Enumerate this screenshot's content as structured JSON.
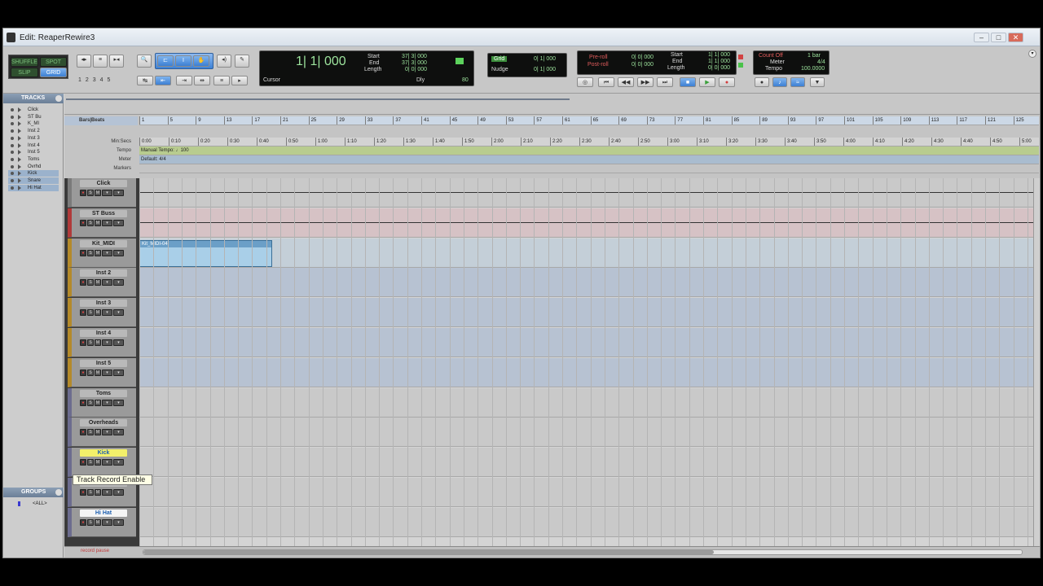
{
  "window": {
    "title": "Edit: ReaperRewire3",
    "minimize": "–",
    "maximize": "□",
    "close": "✕"
  },
  "edit_modes": {
    "shuffle": "SHUFFLE",
    "spot": "SPOT",
    "slip": "SLIP",
    "grid": "GRID"
  },
  "zoom_presets": [
    "1",
    "2",
    "3",
    "4",
    "5"
  ],
  "counter": {
    "main": "1| 1| 000",
    "start_label": "Start",
    "end_label": "End",
    "length_label": "Length",
    "start": "37| 3| 000",
    "end": "37| 3| 000",
    "length": "0| 0| 000",
    "cursor_label": "Cursor",
    "dly_label": "Dly",
    "value": "80"
  },
  "grid_nudge": {
    "grid_label": "Grid",
    "grid_value": "0| 1| 000",
    "nudge_label": "Nudge",
    "nudge_value": "0| 1| 000"
  },
  "preroll": {
    "pre_label": "Pre-roll",
    "post_label": "Post-roll",
    "pre": "0| 0| 000",
    "post": "0| 0| 000",
    "start_label": "Start",
    "end_label": "End",
    "length_label": "Length",
    "start": "1| 1| 000",
    "end": "1| 1| 000",
    "length": "0| 0| 000"
  },
  "count_off": {
    "label": "Count Off",
    "bars": "1 bar",
    "meter_label": "Meter",
    "meter": "4/4",
    "tempo_label": "Tempo",
    "tempo": "100.0000"
  },
  "panels": {
    "tracks": "TRACKS",
    "groups": "GROUPS",
    "all_group": "<ALL>"
  },
  "tracklist": [
    "Click",
    "ST Bu",
    "K_MI",
    "Inst 2",
    "Inst 3",
    "Inst 4",
    "Inst 5",
    "Toms",
    "Ovrhd",
    "Kick",
    "Snare",
    "Hi Hat"
  ],
  "rulers": {
    "bars_label": "Bars|Beats",
    "min_secs_label": "Min:Secs",
    "tempo_label": "Tempo",
    "meter_label": "Meter",
    "markers_label": "Markers",
    "tempo_text": "Manual Tempo:  ♩100",
    "meter_text": "Default: 4/4",
    "bars": [
      "1",
      "5",
      "9",
      "13",
      "17",
      "21",
      "25",
      "29",
      "33",
      "37",
      "41",
      "45",
      "49",
      "53",
      "57",
      "61",
      "65",
      "69",
      "73",
      "77",
      "81",
      "85",
      "89",
      "93",
      "97",
      "101",
      "105",
      "109",
      "113",
      "117",
      "121",
      "125"
    ],
    "mins": [
      "0:00",
      "0:10",
      "0:20",
      "0:30",
      "0:40",
      "0:50",
      "1:00",
      "1:10",
      "1:20",
      "1:30",
      "1:40",
      "1:50",
      "2:00",
      "2:10",
      "2:20",
      "2:30",
      "2:40",
      "2:50",
      "3:00",
      "3:10",
      "3:20",
      "3:30",
      "3:40",
      "3:50",
      "4:00",
      "4:10",
      "4:20",
      "4:30",
      "4:40",
      "4:50",
      "5:00"
    ]
  },
  "tracks": [
    {
      "name": "Click",
      "color": "#7a7a7a",
      "lane": "#c9c9c9"
    },
    {
      "name": "ST Buss",
      "color": "#b03a3a",
      "lane": "#d6c2c5"
    },
    {
      "name": "Kit_MIDI",
      "color": "#b48a2a",
      "lane": "#c4cfd8"
    },
    {
      "name": "Inst 2",
      "color": "#b48a2a",
      "lane": "#b7c2d2"
    },
    {
      "name": "Inst 3",
      "color": "#b48a2a",
      "lane": "#b7c2d2"
    },
    {
      "name": "Inst 4",
      "color": "#b48a2a",
      "lane": "#b7c2d2"
    },
    {
      "name": "Inst 5",
      "color": "#b48a2a",
      "lane": "#b7c2d2"
    },
    {
      "name": "Toms",
      "color": "#6c6c8e",
      "lane": "#c9c9c9"
    },
    {
      "name": "Overheads",
      "color": "#6c6c8e",
      "lane": "#c9c9c9"
    },
    {
      "name": "Kick",
      "color": "#6c6c8e",
      "lane": "#c9c9c9"
    },
    {
      "name": "Snare",
      "color": "#6c6c8e",
      "lane": "#c9c9c9"
    },
    {
      "name": "Hi Hat",
      "color": "#6c6c8e",
      "lane": "#c9c9c9"
    }
  ],
  "region": {
    "name": "Kit_MIDI-04"
  },
  "tooltip": "Track Record Enable",
  "footer": {
    "status": "record pause"
  }
}
